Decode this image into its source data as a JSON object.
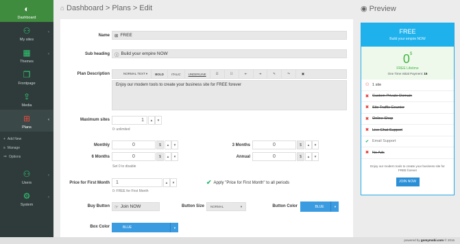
{
  "sidebar": {
    "items": [
      {
        "label": "Dashboard",
        "icon": "dashboard-icon"
      },
      {
        "label": "My sites",
        "icon": "user-icon"
      },
      {
        "label": "Themes",
        "icon": "grid-icon"
      },
      {
        "label": "Frontpage",
        "icon": "pages-icon"
      },
      {
        "label": "Media",
        "icon": "upload-icon"
      },
      {
        "label": "Plans",
        "icon": "gift-icon"
      },
      {
        "label": "Users",
        "icon": "user-icon"
      },
      {
        "label": "System",
        "icon": "gear-icon"
      }
    ],
    "subitems": [
      {
        "label": "Add New"
      },
      {
        "label": "Manage"
      },
      {
        "label": "Options"
      }
    ]
  },
  "header": {
    "breadcrumb_1": "Dashboard",
    "sep": ">",
    "breadcrumb_2": "Plans",
    "current": "Edit",
    "preview_label": "Preview"
  },
  "form": {
    "name_label": "Name",
    "name_value": "FREE",
    "subheading_label": "Sub heading",
    "subheading_value": "Build your empire NOW",
    "description_label": "Plan Description",
    "toolbar": {
      "normal_text": "NORMAL TEXT ▾",
      "bold": "BOLD",
      "italic": "ITALIC",
      "underline": "UNDERLINE"
    },
    "description_value": "Enjoy our modern tools to create your business site for FREE forever",
    "max_sites_label": "Maximum sites",
    "max_sites_value": "1",
    "max_sites_hint": "0: unlimited",
    "monthly_label": "Monthly",
    "monthly_value": "0",
    "three_months_label": "3 Months",
    "three_months_value": "0",
    "six_months_label": "6 Months",
    "six_months_value": "0",
    "annual_label": "Annual",
    "annual_value": "0",
    "currency": "$",
    "disable_hint": "Set 0 to disable",
    "first_month_label": "Price for First Month",
    "first_month_value": "1",
    "first_month_hint": "0: FREE for First Month",
    "apply_label": "Apply \"Price for First Month\" to all periods",
    "buy_button_label": "Buy Button",
    "buy_button_value": "Join NOW",
    "button_size_label": "Button Size",
    "button_size_value": "NORMAL",
    "button_color_label": "Button Color",
    "button_color_value": "BLUE",
    "box_color_label": "Box Color",
    "box_color_value": "BLUE"
  },
  "preview": {
    "name": "FREE",
    "subheading": "Build your empire NOW",
    "price": "0",
    "currency": "$",
    "lifetime": "FREE Lifetime",
    "initial_label": "One Time Initial Payment:",
    "initial_value": "15",
    "features": [
      {
        "text": "1 site",
        "state": "user"
      },
      {
        "text": "Custom Private Domain",
        "state": "no"
      },
      {
        "text": "Site Traffic Counter",
        "state": "no"
      },
      {
        "text": "Online Shop",
        "state": "no"
      },
      {
        "text": "Live Chat Support",
        "state": "no"
      },
      {
        "text": "Email Support",
        "state": "yes"
      },
      {
        "text": "No Ads",
        "state": "no"
      }
    ],
    "description": "Enjoy our modern tools to create your business site for FREE forever",
    "join_label": "JOIN NOW"
  },
  "footer": {
    "prefix": "powered by",
    "brand": "gomymobi.com",
    "year": "© 2016"
  },
  "colors": {
    "sidebar_bg": "#2f3b3b",
    "active_green": "#3f8c3f",
    "preview_blue": "#1fb1ec",
    "button_blue": "#3a9be0"
  }
}
